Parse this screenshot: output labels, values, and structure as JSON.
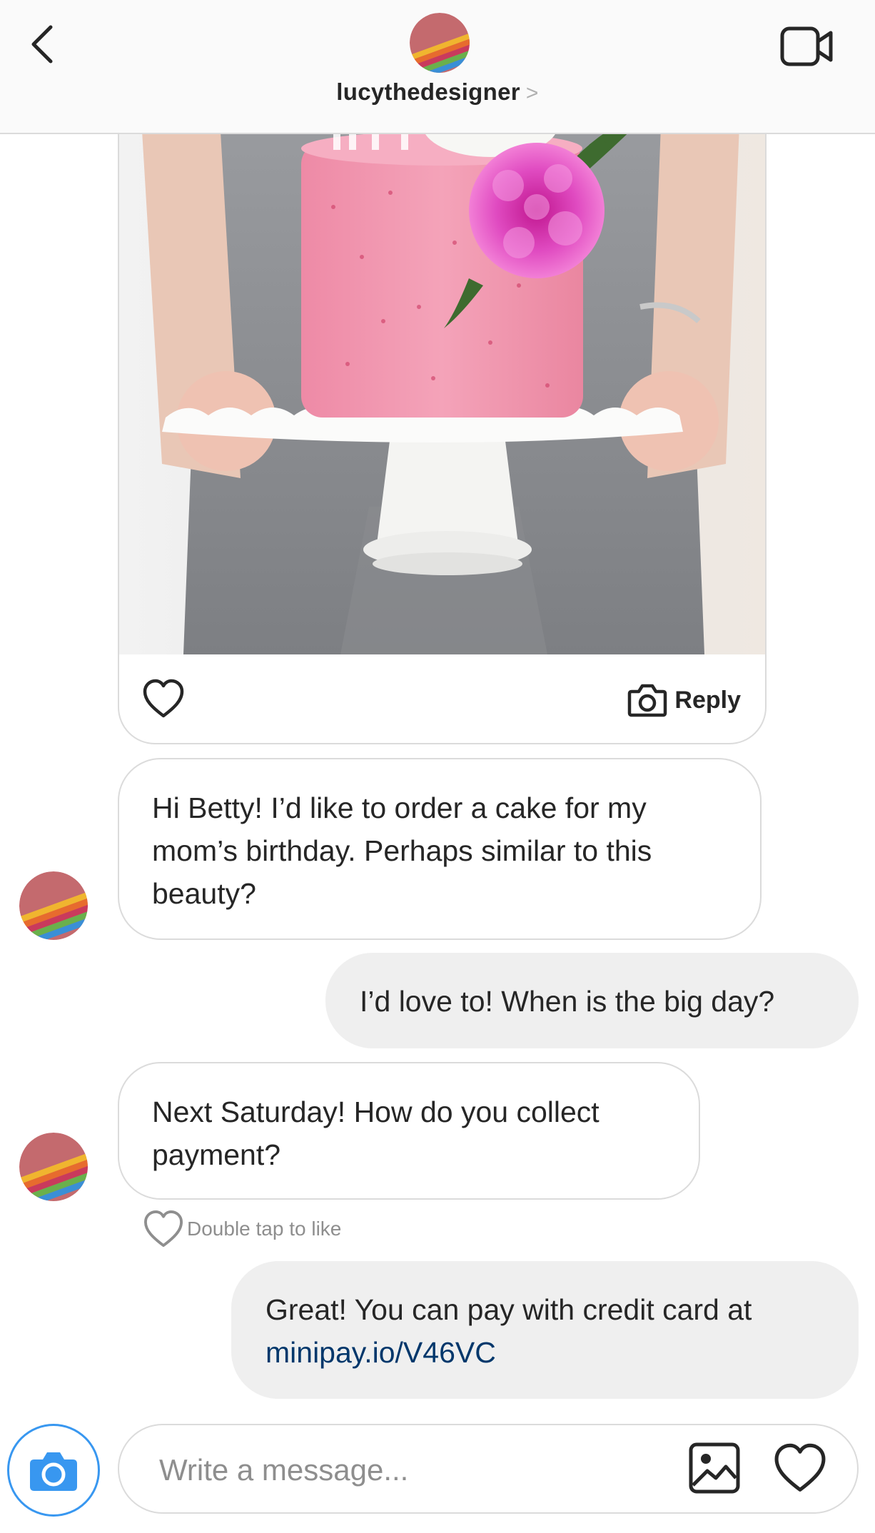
{
  "header": {
    "username": "lucythedesigner",
    "chevron": ">",
    "back_icon": "chevron-left-icon",
    "video_icon": "video-call-icon"
  },
  "shared_post": {
    "reply_label": "Reply",
    "like_icon": "heart-outline-icon",
    "camera_icon": "camera-icon"
  },
  "messages": [
    {
      "from": "lucythedesigner",
      "text": "Hi Betty! I’d like to order a cake for my mom’s birthday. Perhaps similar to this beauty?"
    },
    {
      "from": "me",
      "text": "I’d love to! When is the big day?"
    },
    {
      "from": "lucythedesigner",
      "text": "Next Saturday! How do you collect payment?"
    },
    {
      "from": "me",
      "text": "Great! You can pay with credit card at",
      "link": "minipay.io/V46VC"
    }
  ],
  "double_tap_hint": "Double tap to like",
  "composer": {
    "placeholder": "Write a message...",
    "camera_icon": "camera-icon",
    "gallery_icon": "gallery-icon",
    "heart_icon": "heart-outline-icon"
  },
  "colors": {
    "accent": "#3897f0",
    "link": "#00376b",
    "outgoing_bubble": "#efefef",
    "border": "#dbdbdb",
    "muted_text": "#8e8e8e"
  }
}
